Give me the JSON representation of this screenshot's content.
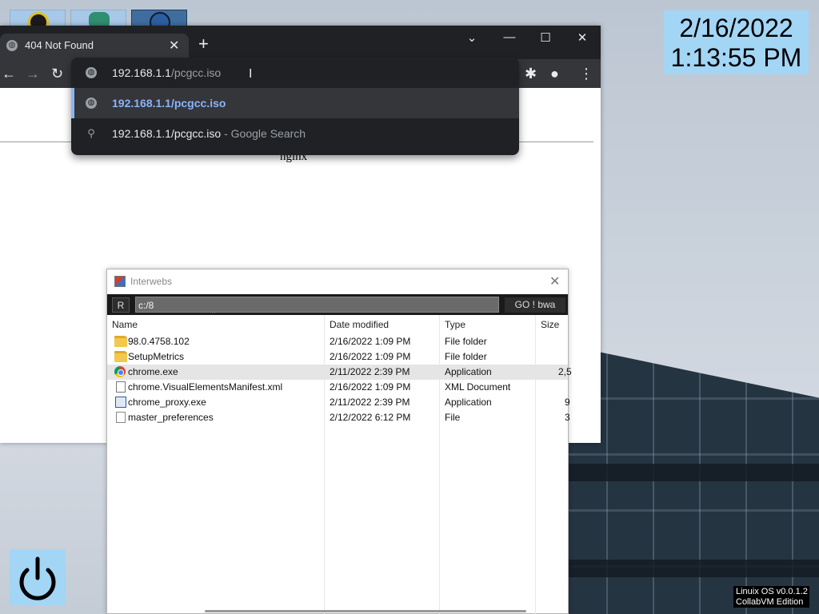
{
  "clock": {
    "date": "2/16/2022",
    "time": "1:13:55 PM"
  },
  "desktop_icons": [
    {
      "icon": "bomb-icon"
    },
    {
      "icon": "creature-icon"
    },
    {
      "icon": "globe-icon"
    }
  ],
  "browser": {
    "tab_title": "404 Not Found",
    "address_host": "192.168.1.1",
    "address_path": "/pcgcc.iso",
    "page_server": "nginx",
    "suggestions": [
      {
        "icon": "globe-icon",
        "text": "192.168.1.1/pcgcc.iso"
      },
      {
        "icon": "search-icon",
        "text": "192.168.1.1/pcgcc.iso",
        "suffix": "- Google Search"
      }
    ],
    "accent": "#8ab4f8"
  },
  "explorer": {
    "title": "Interwebs",
    "refresh_label": "R",
    "path": "c:/8",
    "go_label": "GO ! bwa",
    "columns": [
      "Name",
      "Date modified",
      "Type",
      "Size"
    ],
    "files": [
      {
        "icon": "folder-icon",
        "name": "98.0.4758.102",
        "date": "2/16/2022 1:09 PM",
        "type": "File folder",
        "size": ""
      },
      {
        "icon": "folder-icon",
        "name": "SetupMetrics",
        "date": "2/16/2022 1:09 PM",
        "type": "File folder",
        "size": ""
      },
      {
        "icon": "chrome-icon",
        "name": "chrome.exe",
        "date": "2/11/2022 2:39 PM",
        "type": "Application",
        "size": "2,5",
        "selected": true
      },
      {
        "icon": "xml-file-icon",
        "name": "chrome.VisualElementsManifest.xml",
        "date": "2/16/2022 1:09 PM",
        "type": "XML Document",
        "size": ""
      },
      {
        "icon": "exe-icon",
        "name": "chrome_proxy.exe",
        "date": "2/11/2022 2:39 PM",
        "type": "Application",
        "size": "9"
      },
      {
        "icon": "file-icon",
        "name": "master_preferences",
        "date": "2/12/2022 6:12 PM",
        "type": "File",
        "size": "3"
      }
    ]
  },
  "os_badge": {
    "line1": "Linuix OS v0.0.1.2",
    "line2": "CollabVM Edition"
  }
}
